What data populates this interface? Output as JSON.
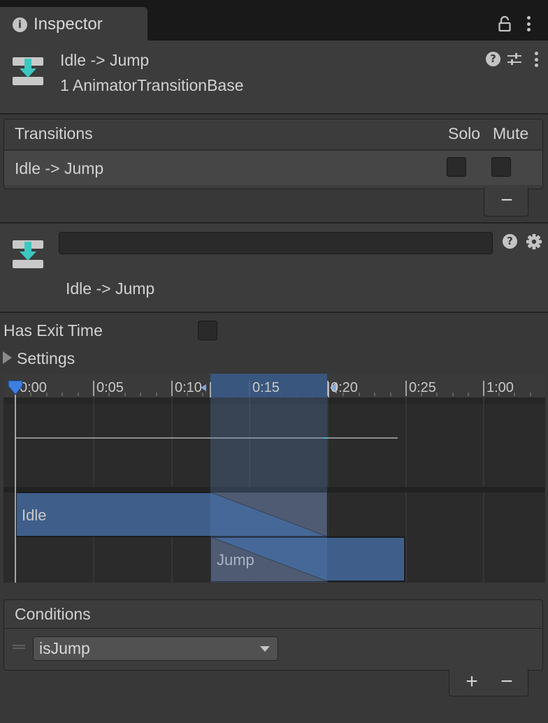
{
  "tab": {
    "title": "Inspector",
    "info_icon": "info-icon"
  },
  "header": {
    "title": "Idle -> Jump",
    "subtitle": "1 AnimatorTransitionBase"
  },
  "transitions_list": {
    "col_transitions": "Transitions",
    "col_solo": "Solo",
    "col_mute": "Mute",
    "rows": [
      {
        "label": "Idle -> Jump",
        "solo": false,
        "mute": false
      }
    ],
    "remove_label": "−"
  },
  "transition": {
    "name_value": "",
    "subtitle": "Idle -> Jump",
    "has_exit_time_label": "Has Exit Time",
    "has_exit_time": false,
    "settings_label": "Settings"
  },
  "timeline": {
    "ticks": [
      "0:00",
      "0:05",
      "0:10",
      "0:15",
      "0:20",
      "0:25",
      "1:00"
    ],
    "source_state": "Idle",
    "destination_state": "Jump"
  },
  "conditions": {
    "title": "Conditions",
    "items": [
      {
        "parameter": "isJump"
      }
    ],
    "add_label": "+",
    "remove_label": "−"
  },
  "colors": {
    "accent_blue": "#3f5f8a",
    "transition_highlight": "#3a5478",
    "panel": "#3c3c3c",
    "timeline_bg": "#2b2b2b"
  }
}
